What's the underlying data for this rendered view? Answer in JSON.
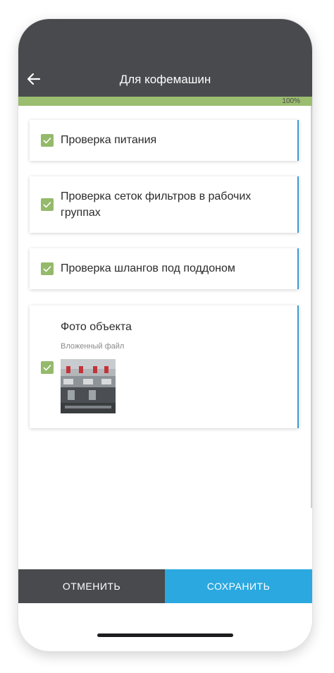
{
  "header": {
    "title": "Для кофемашин",
    "back_icon": "arrow-left-icon"
  },
  "progress": {
    "value_fraction": 1.0,
    "label": "100%",
    "color": "#9bbd6f"
  },
  "checklist": {
    "items": [
      {
        "label": "Проверка питания",
        "checked": true
      },
      {
        "label": "Проверка сеток фильтров в рабочих группах",
        "checked": true
      },
      {
        "label": "Проверка шлангов под поддоном",
        "checked": true
      },
      {
        "label": "Фото объекта",
        "sublabel": "Вложенный файл",
        "checked": true
      }
    ]
  },
  "footer": {
    "cancel_label": "ОТМЕНИТЬ",
    "save_label": "СОХРАНИТЬ"
  },
  "colors": {
    "header_bg": "#484a4e",
    "accent_blue": "#2ba8e0",
    "check_green": "#95b96a"
  }
}
